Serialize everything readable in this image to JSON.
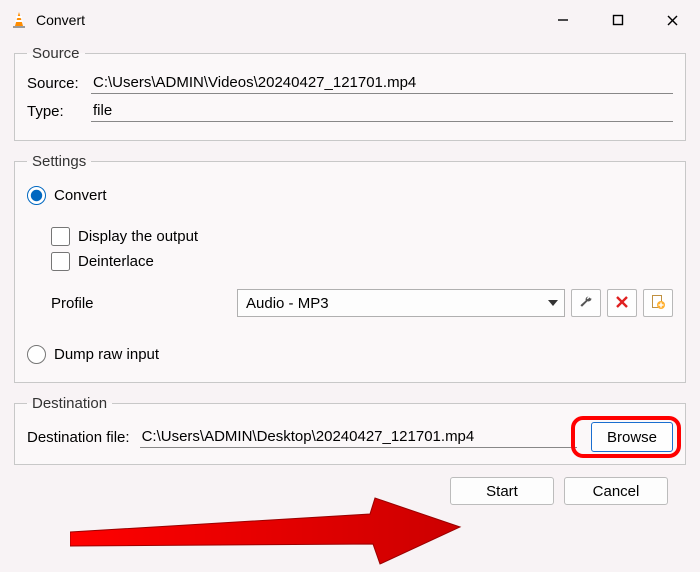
{
  "window": {
    "title": "Convert"
  },
  "source": {
    "legend": "Source",
    "source_label": "Source:",
    "source_value": "C:\\Users\\ADMIN\\Videos\\20240427_121701.mp4",
    "type_label": "Type:",
    "type_value": "file"
  },
  "settings": {
    "legend": "Settings",
    "convert_label": "Convert",
    "display_output_label": "Display the output",
    "deinterlace_label": "Deinterlace",
    "profile_label": "Profile",
    "profile_value": "Audio - MP3",
    "dump_raw_label": "Dump raw input"
  },
  "destination": {
    "legend": "Destination",
    "dest_label": "Destination file:",
    "dest_value": "C:\\Users\\ADMIN\\Desktop\\20240427_121701.mp4",
    "browse_label": "Browse"
  },
  "footer": {
    "start_label": "Start",
    "cancel_label": "Cancel"
  }
}
